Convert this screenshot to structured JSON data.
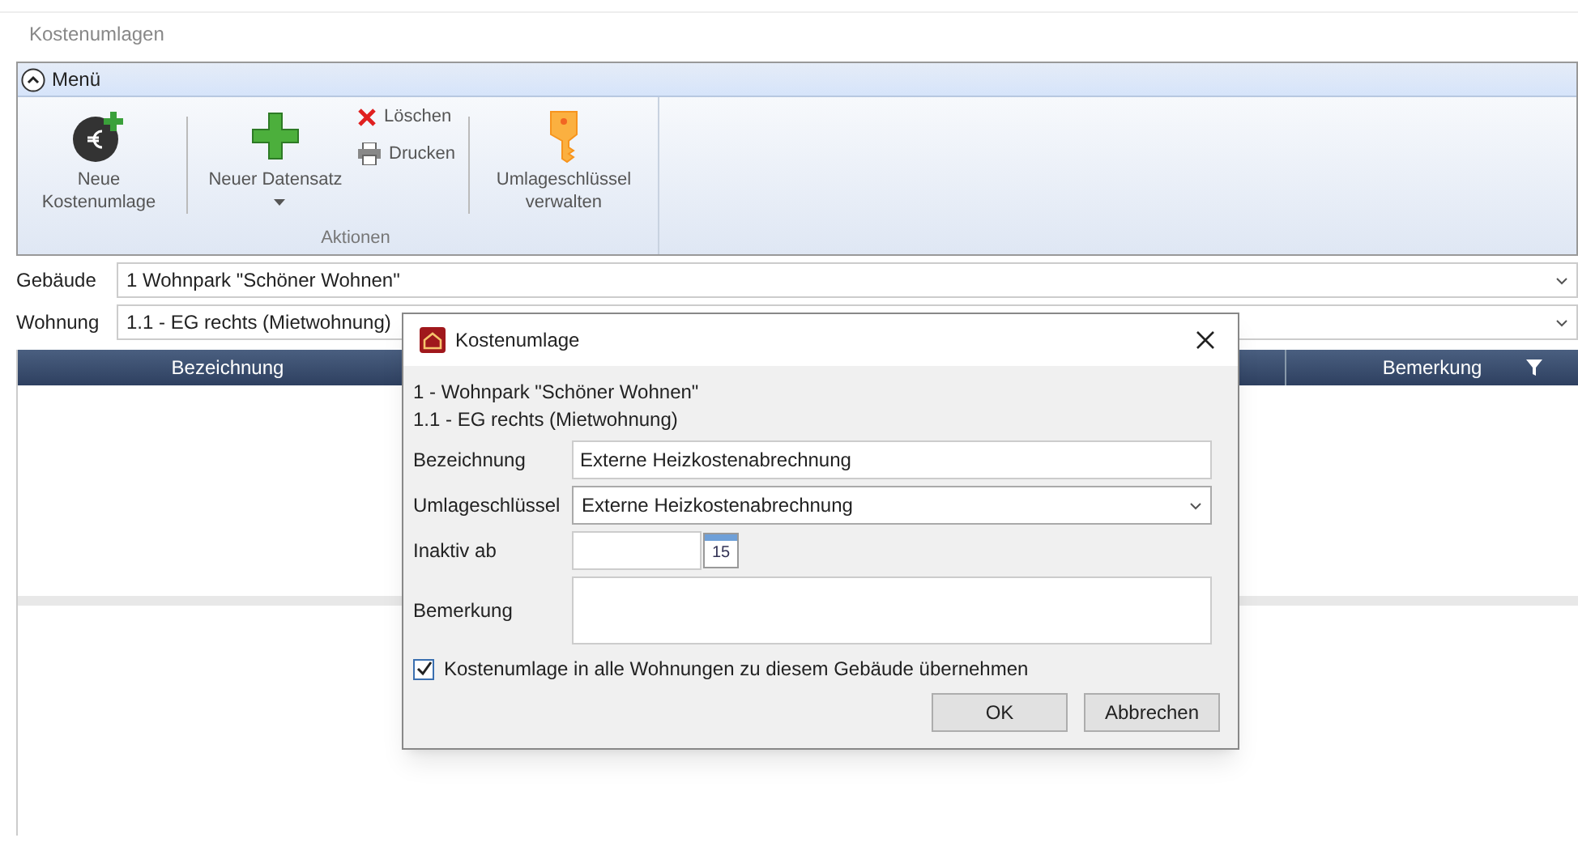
{
  "window": {
    "title": "Kostenumlagen"
  },
  "ribbon": {
    "menu_label": "Menü",
    "expanded": true,
    "actions": [
      {
        "kind": "large",
        "label": "Neue Kostenumlage",
        "dropdown": false
      },
      {
        "kind": "large",
        "label": "Neuer Datensatz",
        "dropdown": true
      },
      {
        "kind": "small",
        "label": "Löschen"
      },
      {
        "kind": "small",
        "label": "Drucken"
      },
      {
        "kind": "large",
        "label": "Umlageschlüssel verwalten",
        "dropdown": false
      }
    ],
    "group_label": "Aktionen"
  },
  "filters": [
    {
      "label": "Gebäude",
      "value": "1 Wohnpark \"Schöner Wohnen\""
    },
    {
      "label": "Wohnung",
      "value": "1.1 - EG rechts (Mietwohnung)"
    }
  ],
  "table": {
    "columns": [
      "Bezeichnung",
      "Bemerkung"
    ]
  },
  "dialog": {
    "title": "Kostenumlage",
    "context": [
      "1 - Wohnpark \"Schöner Wohnen\"",
      "1.1 - EG rechts (Mietwohnung)"
    ],
    "fields": [
      {
        "kind": "text",
        "label": "Bezeichnung",
        "value": "Externe Heizkostenabrechnung"
      },
      {
        "kind": "select",
        "label": "Umlageschlüssel",
        "value": "Externe Heizkostenabrechnung"
      },
      {
        "kind": "date",
        "label": "Inaktiv ab"
      },
      {
        "kind": "textarea",
        "label": "Bemerkung"
      }
    ],
    "checkbox": {
      "label": "Kostenumlage in alle Wohnungen zu diesem Gebäude übernehmen",
      "checked": true
    },
    "calendar_day": "15",
    "buttons": [
      "OK",
      "Abbrechen"
    ]
  }
}
